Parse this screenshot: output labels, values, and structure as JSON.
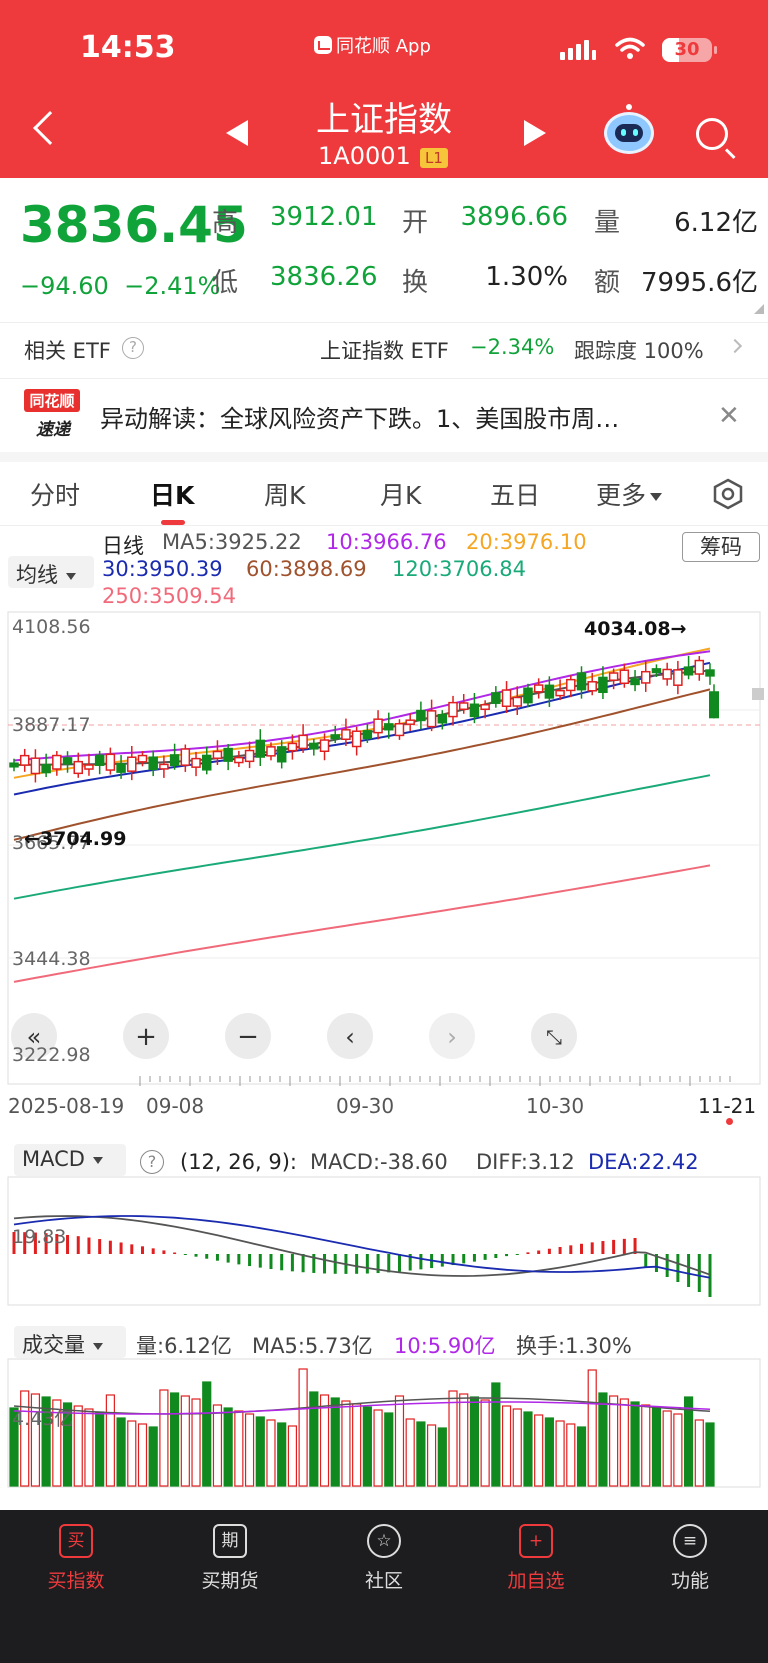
{
  "status": {
    "time": "14:53",
    "app": "同花顺 App",
    "battery": "30"
  },
  "header": {
    "title": "上证指数",
    "code": "1A0001",
    "level": "L1"
  },
  "quote": {
    "price": "3836.45",
    "change": "−94.60",
    "change_pct": "−2.41%",
    "high_label": "高",
    "high": "3912.01",
    "open_label": "开",
    "open": "3896.66",
    "vol_label": "量",
    "vol": "6.12亿",
    "low_label": "低",
    "low": "3836.26",
    "turn_label": "换",
    "turn": "1.30%",
    "amount_label": "额",
    "amount": "7995.6亿"
  },
  "etf": {
    "label": "相关 ETF",
    "name": "上证指数 ETF",
    "change": "−2.34%",
    "track": "跟踪度 100%"
  },
  "news": {
    "badge_top": "同花顺",
    "badge_bottom": "速递",
    "text": "异动解读：全球风险资产下跌。1、美国股市周…"
  },
  "tabs": [
    "分时",
    "日K",
    "周K",
    "月K",
    "五日",
    "更多"
  ],
  "ma_legend": {
    "selector": "均线",
    "kind": "日线",
    "ma5": "MA5:3925.22",
    "ma10": "10:3966.76",
    "ma20": "20:3976.10",
    "ma30": "30:3950.39",
    "ma60": "60:3898.69",
    "ma120": "120:3706.84",
    "ma250": "250:3509.54",
    "chips": "筹码"
  },
  "colors": {
    "up": "#e02020",
    "down": "#108a1e",
    "ma5": "#555555",
    "ma10": "#b027e8",
    "ma20": "#f5a623",
    "ma30": "#1a2bb0",
    "ma60": "#a0522d",
    "ma120": "#1aaa78",
    "ma250": "#f06a7a"
  },
  "kline": {
    "price_axis": [
      "4108.56",
      "3887.17",
      "3665.77",
      "3444.38",
      "3222.98"
    ],
    "high_marker": "4034.08→",
    "low_marker": "←3704.99",
    "dates": [
      "2025-08-19",
      "09-08",
      "09-30",
      "10-30",
      "11-21"
    ]
  },
  "chart_data": {
    "type": "candlestick",
    "ylim": [
      3222.98,
      4108.56
    ],
    "y_ticks": [
      4108.56,
      3887.17,
      3665.77,
      3444.38,
      3222.98
    ],
    "x_labels": [
      "2025-08-19",
      "09-08",
      "09-30",
      "10-30",
      "11-21"
    ],
    "last": {
      "open": 3896.66,
      "high": 3912.01,
      "low": 3836.26,
      "close": 3836.45
    },
    "ma": {
      "MA5": 3925.22,
      "MA10": 3966.76,
      "MA20": 3976.1,
      "MA30": 3950.39,
      "MA60": 3898.69,
      "MA120": 3706.84,
      "MA250": 3509.54
    },
    "max_marker": 4034.08,
    "min_marker": 3704.99
  },
  "macd": {
    "label": "MACD",
    "params": "(12, 26, 9):",
    "macd": "MACD:-38.60",
    "diff": "DIFF:3.12",
    "dea": "DEA:22.42",
    "axis": "19.83"
  },
  "volume": {
    "label": "成交量",
    "vol": "量:6.12亿",
    "ma5": "MA5:5.73亿",
    "ma10": "10:5.90亿",
    "turn": "换手:1.30%",
    "axis": "4.43亿"
  },
  "nav": [
    {
      "icon": "买",
      "label": "买指数"
    },
    {
      "icon": "期",
      "label": "买期货"
    },
    {
      "icon": "☆",
      "label": "社区"
    },
    {
      "icon": "+",
      "label": "加自选"
    },
    {
      "icon": "≡",
      "label": "功能"
    }
  ]
}
